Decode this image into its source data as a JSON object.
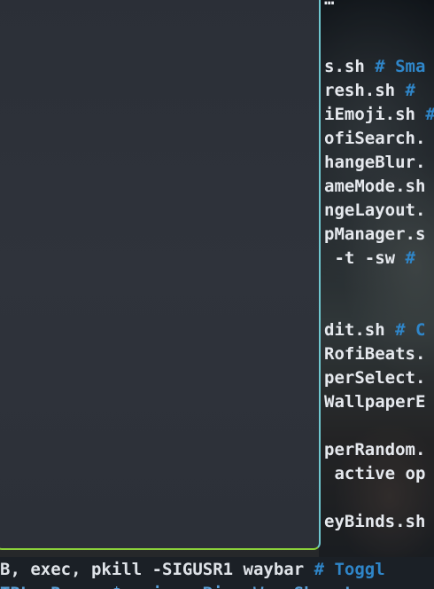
{
  "editor": {
    "lines": [
      {
        "code": "…",
        "comment": ""
      },
      {
        "code": "s.sh",
        "comment": " # Sma"
      },
      {
        "code": "resh.sh",
        "comment": " #"
      },
      {
        "code": "iEmoji.sh",
        "comment": " #"
      },
      {
        "code": "ofiSearch.",
        "comment": ""
      },
      {
        "code": "hangeBlur.",
        "comment": ""
      },
      {
        "code": "ameMode.sh",
        "comment": ""
      },
      {
        "code": "ngeLayout.",
        "comment": ""
      },
      {
        "code": "pManager.s",
        "comment": ""
      },
      {
        "code": " -t -sw",
        "comment": " #"
      },
      {
        "code": "dit.sh",
        "comment": " # C"
      },
      {
        "code": "RofiBeats.",
        "comment": ""
      },
      {
        "code": "perSelect.",
        "comment": ""
      },
      {
        "code": "WallpaperE",
        "comment": ""
      },
      {
        "code": "perRandom.",
        "comment": ""
      },
      {
        "code": " active op",
        "comment": ""
      },
      {
        "code": "eyBinds.sh",
        "comment": ""
      }
    ],
    "bottom_line": {
      "code": "B, exec, pkill -SIGUSR1 waybar",
      "comment": " # Toggl"
    },
    "bottom_line_2": "TRL, Re... $...ip...Bi...W...Sb...L"
  },
  "colors": {
    "window_border": "#8bd13a",
    "comment": "#2f86c9",
    "window_bg": "#2e323a"
  }
}
